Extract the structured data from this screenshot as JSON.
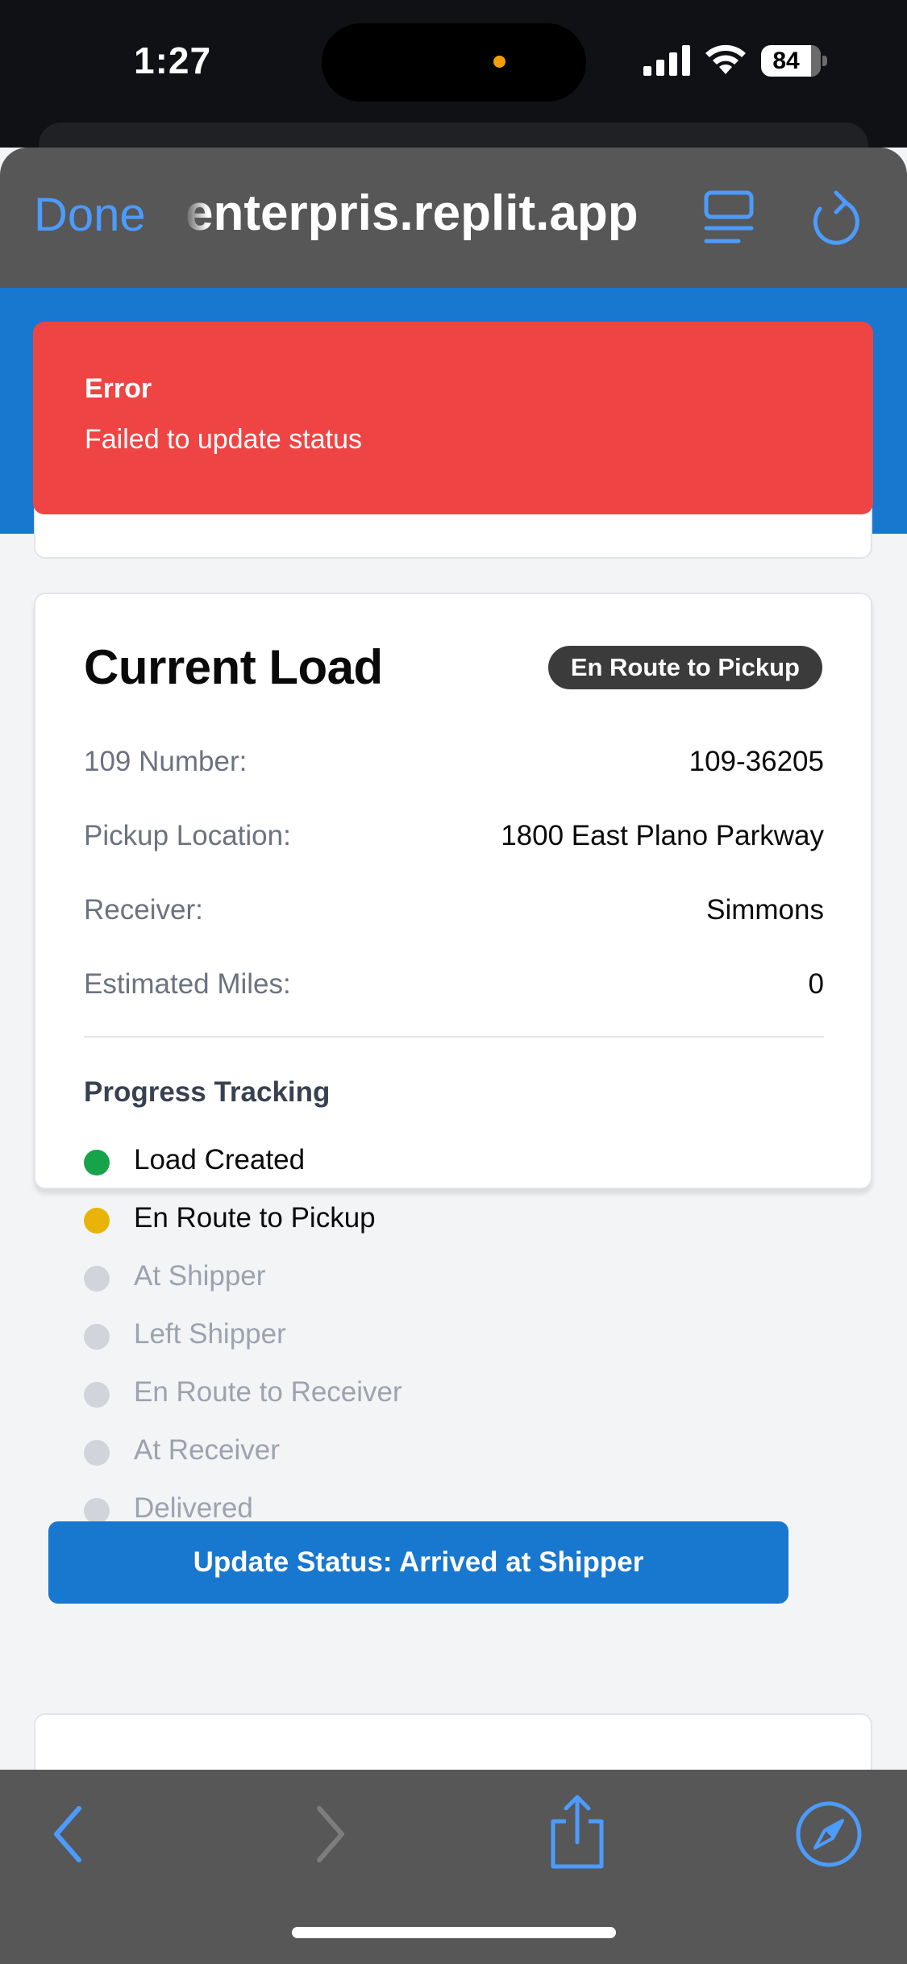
{
  "status_bar": {
    "time": "1:27",
    "battery_level": "84",
    "signal_icon": "cellular-signal-icon",
    "wifi_icon": "wifi-icon"
  },
  "browser": {
    "done_label": "Done",
    "url": "enterpris.replit.app",
    "reader_icon": "reader-view-icon",
    "reload_icon": "reload-icon",
    "accent_color": "#4c9bff"
  },
  "toast": {
    "title": "Error",
    "message": "Failed to update status",
    "color": "#ef4444"
  },
  "load_card": {
    "title": "Current Load",
    "status_badge": "En Route to Pickup",
    "details": [
      {
        "label": "109 Number:",
        "value": "109-36205"
      },
      {
        "label": "Pickup Location:",
        "value": "1800 East Plano Parkway"
      },
      {
        "label": "Receiver:",
        "value": "Simmons"
      },
      {
        "label": "Estimated Miles:",
        "value": "0"
      }
    ],
    "progress_heading": "Progress Tracking",
    "steps": [
      {
        "label": "Load Created",
        "state": "complete",
        "color": "#16a34a"
      },
      {
        "label": "En Route to Pickup",
        "state": "current",
        "color": "#eab308"
      },
      {
        "label": "At Shipper",
        "state": "pending",
        "color": "#d1d5db"
      },
      {
        "label": "Left Shipper",
        "state": "pending",
        "color": "#d1d5db"
      },
      {
        "label": "En Route to Receiver",
        "state": "pending",
        "color": "#d1d5db"
      },
      {
        "label": "At Receiver",
        "state": "pending",
        "color": "#d1d5db"
      },
      {
        "label": "Delivered",
        "state": "pending",
        "color": "#d1d5db"
      }
    ],
    "update_button_label": "Update Status: Arrived at Shipper",
    "primary_color": "#1877cf"
  },
  "toolbar": {
    "back_icon": "chevron-left-icon",
    "forward_icon": "chevron-right-icon",
    "share_icon": "share-icon",
    "compass_icon": "compass-icon"
  }
}
